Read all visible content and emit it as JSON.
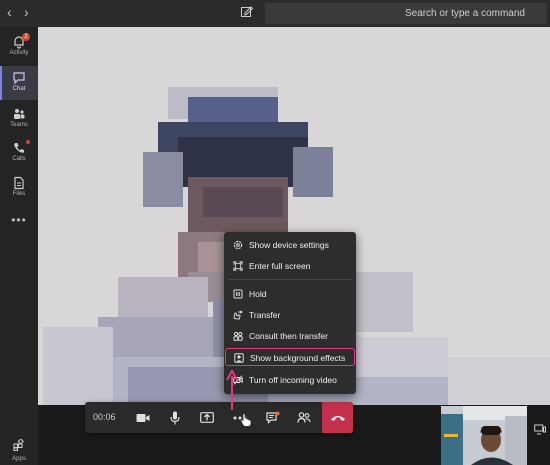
{
  "search": {
    "placeholder": "Search or type a command"
  },
  "rail": {
    "items": [
      {
        "label": "Activity",
        "icon": "bell-icon",
        "badge": "2"
      },
      {
        "label": "Chat",
        "icon": "chat-icon",
        "active": true
      },
      {
        "label": "Teams",
        "icon": "teams-icon"
      },
      {
        "label": "Calls",
        "icon": "phone-icon"
      },
      {
        "label": "Files",
        "icon": "file-icon"
      }
    ],
    "more": "•••",
    "apps_label": "Apps"
  },
  "call_controls": {
    "timer": "00:06",
    "buttons": [
      "camera-icon",
      "mic-icon",
      "share-icon",
      "more-options-icon",
      "chat-bubble-icon",
      "participants-icon",
      "hang-up-icon"
    ]
  },
  "context_menu": {
    "items": [
      {
        "label": "Show device settings",
        "icon": "gear-icon"
      },
      {
        "label": "Enter full screen",
        "icon": "fullscreen-icon"
      },
      {
        "label": "Hold",
        "icon": "hold-icon"
      },
      {
        "label": "Transfer",
        "icon": "transfer-icon"
      },
      {
        "label": "Consult then transfer",
        "icon": "consult-transfer-icon"
      },
      {
        "label": "Show background effects",
        "icon": "background-effects-icon",
        "highlighted": true
      },
      {
        "label": "Turn off incoming video",
        "icon": "video-off-icon"
      }
    ]
  },
  "colors": {
    "accent": "#7b83eb",
    "highlight": "#e6377a",
    "hangup": "#c4314b"
  }
}
